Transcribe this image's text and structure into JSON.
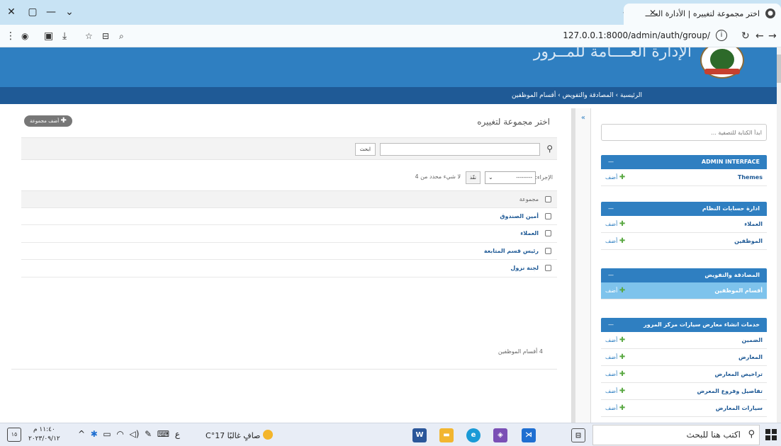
{
  "browser": {
    "tab_title": "اختر مجموعة لتغييره | الأدارة العــــ",
    "url": "127.0.0.1:8000/admin/auth/group/"
  },
  "header": {
    "site_title": "الإدارة العــــامة للمــرور"
  },
  "breadcrumbs": "الرئيسية › المصادقة والتفويض › أقسام الموظفين",
  "sidebar": {
    "filter_placeholder": "ابدأ الكتابة للتصفية ...",
    "modules": [
      {
        "caption": "ADMIN INTERFACE",
        "rows": [
          {
            "model": "Themes",
            "add": "أضف"
          }
        ]
      },
      {
        "caption": "ادارة حسابات النظام",
        "rows": [
          {
            "model": "العملاء",
            "add": "أضف"
          },
          {
            "model": "الموظفين",
            "add": "أضف"
          }
        ]
      },
      {
        "caption": "المصادقة والتفويض",
        "rows": [
          {
            "model": "أقسام الموظفين",
            "add": "أضف"
          }
        ]
      },
      {
        "caption": "خدمات انشاء معارض سيارات مركز المرور",
        "rows": [
          {
            "model": "الضمين",
            "add": "أضف"
          },
          {
            "model": "المعارض",
            "add": "أضف"
          },
          {
            "model": "تراخيص المعارض",
            "add": "أضف"
          },
          {
            "model": "تفاصيل وفروع المعرض",
            "add": "أضف"
          },
          {
            "model": "سيارات المعارض",
            "add": "أضف"
          }
        ]
      }
    ],
    "toggle": "»"
  },
  "content": {
    "title": "اختر مجموعة لتغييره",
    "add_button": "أضف مجموعة",
    "search_button": "ابحث",
    "action_label": "الإجراء:",
    "action_select": "---------",
    "go_button": "نفّذ",
    "selection_counter": "لا شيء محدد من 4",
    "column_header": "مجموعة",
    "rows": [
      "أمين الصندوق",
      "العملاء",
      "رئيس قسم المتابعة",
      "لجنة نزول"
    ],
    "paginator": "4 أقسام الموظفين"
  },
  "taskbar": {
    "search_placeholder": "اكتب هنا للبحث",
    "weather": "صافٍ غالبًا 17°C",
    "time": "١١:٤٠ م",
    "date": "٢٠٢٣/٠٩/١٢",
    "lang": "ع",
    "notif": "١٥"
  }
}
